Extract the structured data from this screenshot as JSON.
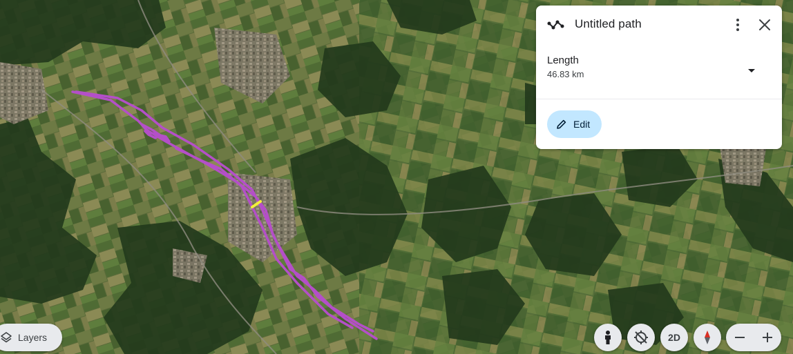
{
  "map": {
    "view": "satellite",
    "path_color": "#b44fc8",
    "marker_color": "#f2ef3a",
    "icon": "satellite-map"
  },
  "panel": {
    "icon": "path-icon",
    "title": "Untitled path",
    "measurement_label": "Length",
    "measurement_value": "46.83 km",
    "edit_label": "Edit",
    "edit_color": "#c2e7ff"
  },
  "layers": {
    "label": "Layers",
    "icon": "layers-icon"
  },
  "controls": {
    "street_view_icon": "pegman-icon",
    "rotate_icon": "reset-tilt-icon",
    "view_mode_label": "2D",
    "compass_icon": "compass-icon",
    "zoom_out_icon": "minus-icon",
    "zoom_in_icon": "plus-icon"
  }
}
